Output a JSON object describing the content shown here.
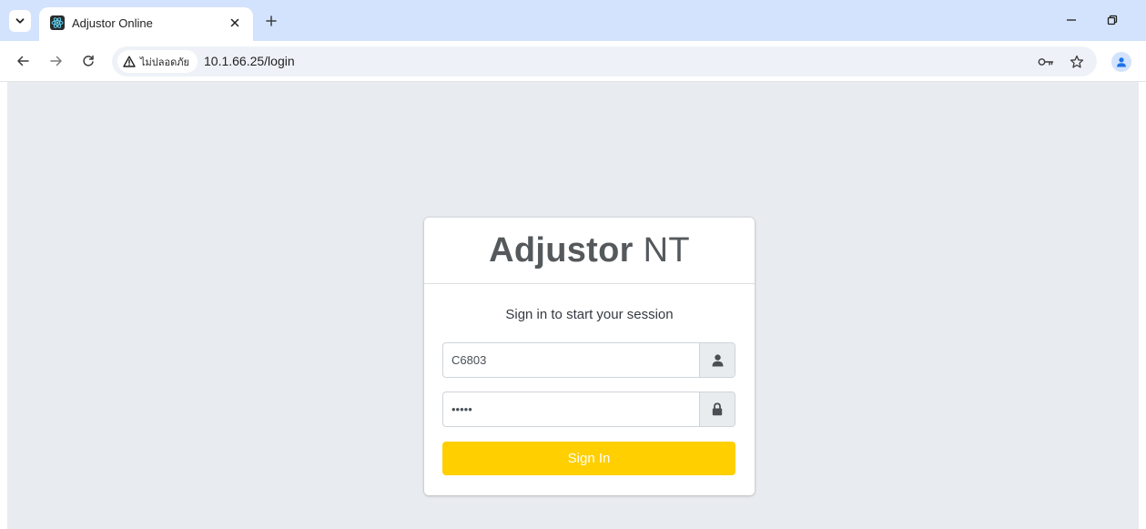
{
  "browser": {
    "tab": {
      "title": "Adjustor Online",
      "favicon": "react-logo-icon",
      "close_label": "×"
    },
    "new_tab_label": "+",
    "address_bar": {
      "security_label": "ไม่ปลอดภัย",
      "url": "10.1.66.25/login"
    },
    "icons": {
      "tab_search": "chevron-down-icon",
      "back": "arrow-left-icon",
      "forward": "arrow-right-icon",
      "reload": "reload-icon",
      "warning": "warning-triangle-icon",
      "password_key": "key-icon",
      "bookmark": "star-icon",
      "profile": "person-icon",
      "minimize": "minimize-icon",
      "restore": "restore-icon"
    }
  },
  "login": {
    "brand_bold": "Adjustor",
    "brand_light": "NT",
    "subtitle": "Sign in to start your session",
    "username": {
      "value": "C6803",
      "icon": "user-icon"
    },
    "password": {
      "value": "•••••",
      "icon": "lock-icon"
    },
    "submit_label": "Sign In"
  },
  "colors": {
    "tabstrip": "#d3e3fd",
    "page_background": "#e8ebef",
    "button": "#ffcf00",
    "brand_text": "#55595c"
  }
}
